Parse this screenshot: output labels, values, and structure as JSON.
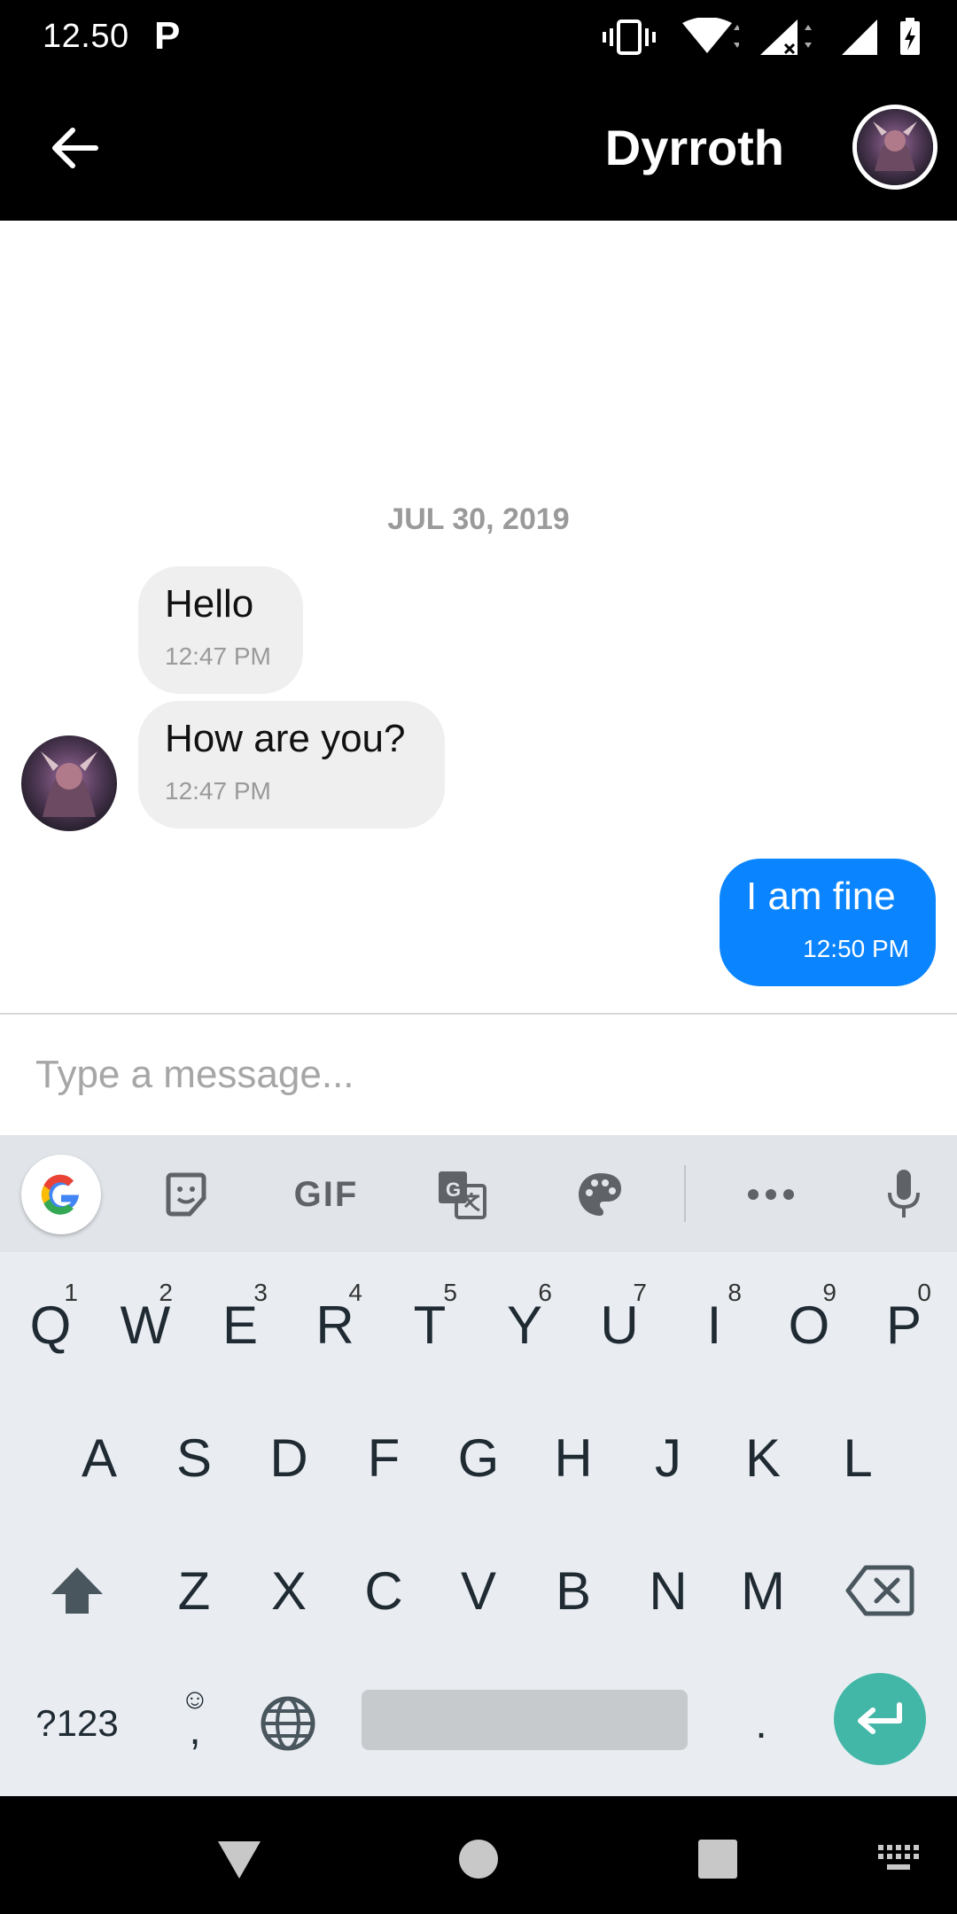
{
  "status_bar": {
    "time": "12.50",
    "app_letter": "P"
  },
  "header": {
    "contact_name": "Dyrroth"
  },
  "messages": {
    "date": "JUL 30, 2019",
    "items": [
      {
        "direction": "in",
        "text": "Hello",
        "time": "12:47 PM"
      },
      {
        "direction": "in",
        "text": "How are you?",
        "time": "12:47 PM"
      },
      {
        "direction": "out",
        "text": "I am fine",
        "time": "12:50 PM"
      }
    ]
  },
  "composer": {
    "placeholder": "Type a message..."
  },
  "keyboard": {
    "toolbar": [
      "google-icon",
      "sticker-icon",
      "gif-icon",
      "translate-icon",
      "palette-icon",
      "more-icon",
      "mic-icon"
    ],
    "gif_label": "GIF",
    "row1": [
      {
        "key": "Q",
        "hint": "1"
      },
      {
        "key": "W",
        "hint": "2"
      },
      {
        "key": "E",
        "hint": "3"
      },
      {
        "key": "R",
        "hint": "4"
      },
      {
        "key": "T",
        "hint": "5"
      },
      {
        "key": "Y",
        "hint": "6"
      },
      {
        "key": "U",
        "hint": "7"
      },
      {
        "key": "I",
        "hint": "8"
      },
      {
        "key": "O",
        "hint": "9"
      },
      {
        "key": "P",
        "hint": "0"
      }
    ],
    "row2": [
      "A",
      "S",
      "D",
      "F",
      "G",
      "H",
      "J",
      "K",
      "L"
    ],
    "row3": [
      "Z",
      "X",
      "C",
      "V",
      "B",
      "N",
      "M"
    ],
    "symbols_label": "?123",
    "comma_label": ",",
    "period_label": "."
  },
  "colors": {
    "accent": "#0a84ff",
    "enter": "#43b7a7",
    "incoming": "#efefef"
  }
}
